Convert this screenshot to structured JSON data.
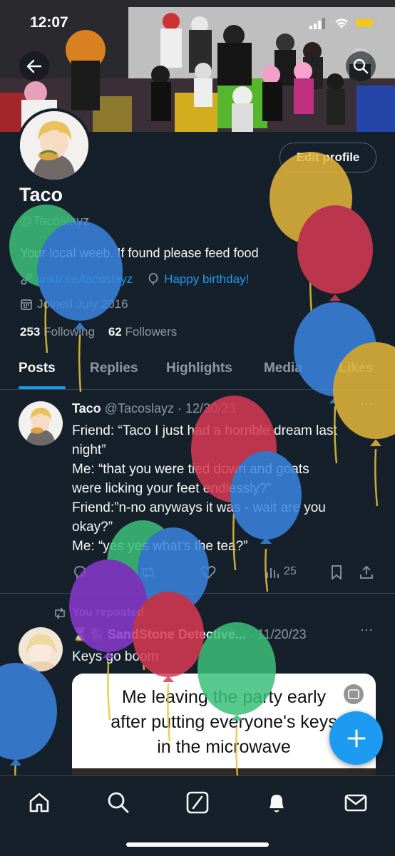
{
  "status": {
    "time": "12:07"
  },
  "profile": {
    "name": "Taco",
    "handle": "@Tacoslayz",
    "bio": "Your local weeb. If found please feed food",
    "link": "linktr.ee/tacoslayz",
    "birthday": "Happy birthday!",
    "joined": "Joined July 2016",
    "following_count": "253",
    "following_label": "Following",
    "followers_count": "62",
    "followers_label": "Followers",
    "edit_label": "Edit profile"
  },
  "tabs": [
    "Posts",
    "Replies",
    "Highlights",
    "Media",
    "Likes"
  ],
  "post1": {
    "name": "Taco",
    "handle": "@Tacoslayz",
    "date": "· 12/30/23",
    "lines": [
      "Friend: “Taco I just had a horrible dream last",
      "night”",
      "Me: “that you were tied down and goats",
      "were licking your feet endlessly?”",
      "Friend:”n-no anyways it was - wait are you",
      "okay?”",
      "Me: “yes yes what's the tea?”"
    ],
    "views": "25"
  },
  "post2": {
    "repost_label": "You reposted",
    "name": "⌛🐈‍⬛ SandStone Detective...",
    "date": "· 11/20/23",
    "text": "Keys go boom",
    "card_lines": [
      "Me leaving the party early",
      "after putting everyone's keys",
      "in the microwave"
    ]
  },
  "nav": [
    "home-icon",
    "search-icon",
    "grok-icon",
    "notifications-icon",
    "messages-icon"
  ],
  "colors": {
    "background": "#15202b",
    "accent": "#1d9bf0",
    "muted": "#8b98a5"
  }
}
